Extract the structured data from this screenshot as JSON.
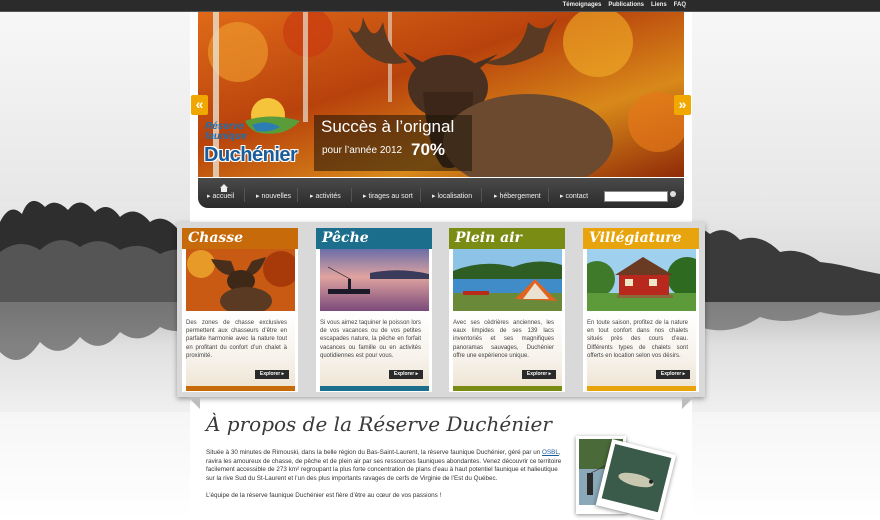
{
  "top_links": [
    "Témoignages",
    "Publications",
    "Liens",
    "FAQ"
  ],
  "hero": {
    "logo_line1": "Réserve",
    "logo_line2": "faunique",
    "logo_line3": "Duchénier",
    "caption_title": "Succès à l’orignal",
    "caption_sub": "pour l’année 2012",
    "caption_pct": "70%",
    "prev": "«",
    "next": "»"
  },
  "nav": {
    "items": [
      "▸ accueil",
      "▸ nouvelles",
      "▸ activités",
      "▸ tirages au sort",
      "▸ localisation",
      "▸ hébergement",
      "▸ contact"
    ],
    "search_placeholder": ""
  },
  "cards": [
    {
      "title": "Chasse",
      "color": "#c76a0a",
      "text": "Des zones de chasse exclusives permettent aux chasseurs d’être en parfaite harmonie avec la nature tout en profitant du confort d’un chalet à proximité.",
      "button": "Explorer ▸"
    },
    {
      "title": "Pêche",
      "color": "#1b6f8c",
      "text": "Si vous aimez taquiner le poisson lors de vos vacances ou de vos petites escapades nature, la pêche en forfait vacances ou famille ou en activités quotidiennes est pour vous.",
      "button": "Explorer ▸"
    },
    {
      "title": "Plein air",
      "color": "#7a8c14",
      "text": "Avec ses cèdrières anciennes, les eaux limpides de ses 139 lacs inventoriés et ses magnifiques panoramas sauvages, Duchénier offre une expérience unique.",
      "button": "Explorer ▸"
    },
    {
      "title": "Villégiature",
      "color": "#e8a40c",
      "text": "En toute saison, profitez de la nature en tout confort dans nos chalets situés près des cours d’eau. Différents types de chalets sont offerts en location selon vos désirs.",
      "button": "Explorer ▸"
    }
  ],
  "about": {
    "title": "À propos de la Réserve Duchénier",
    "p1_before": "Située à 30 minutes de Rimouski, dans la belle région du Bas-Saint-Laurent, la réserve faunique Duchénier, géré par un ",
    "p1_link": "OSBL",
    "p1_after": ", ravira les amoureux de chasse, de pêche et de plein air par ses ressources fauniques abondantes. Venez découvrir ce territoire facilement accessible de 273 km² regroupant la plus forte concentration de plans d’eau à haut potentiel faunique et halieutique sur la rive Sud du St-Laurent et l’un des plus importants ravages de cerfs de Virginie de l’Est du Québec.",
    "p2": "L’équipe de la réserve faunique Duchénier est fière d’être au cœur de vos passions !"
  }
}
